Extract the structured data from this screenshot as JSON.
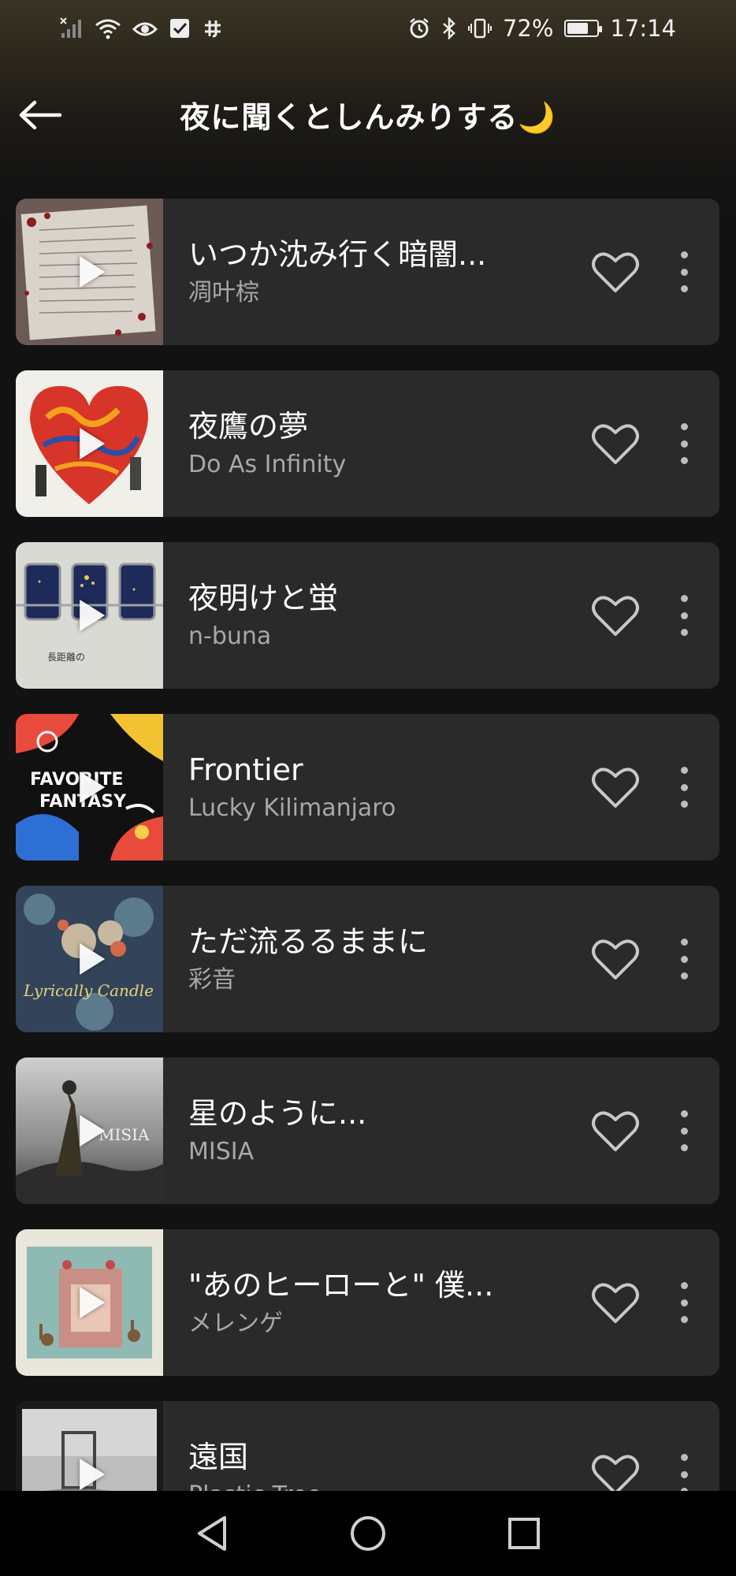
{
  "status_bar": {
    "left_icons": [
      "no-signal-icon",
      "wifi-icon",
      "eye-icon",
      "check-box-icon",
      "app-icon"
    ],
    "alarm_icon": "alarm-icon",
    "bluetooth_icon": "bluetooth-icon",
    "vibrate_icon": "vibrate-icon",
    "battery_percent": "72%",
    "battery_level": 0.72,
    "time": "17:14"
  },
  "header": {
    "back_icon": "arrow-left-icon",
    "title": "夜に聞くとしんみりする🌙"
  },
  "tracks": [
    {
      "title": "いつか沈み行く暗闇...",
      "artist": "凋叶棕"
    },
    {
      "title": "夜鷹の夢",
      "artist": "Do As Infinity"
    },
    {
      "title": "夜明けと蛍",
      "artist": "n-buna"
    },
    {
      "title": "Frontier",
      "artist": "Lucky Kilimanjaro"
    },
    {
      "title": "ただ流るるままに",
      "artist": "彩音"
    },
    {
      "title": "星のように...",
      "artist": "MISIA"
    },
    {
      "title": "\"あのヒーローと\" 僕...",
      "artist": "メレンゲ"
    },
    {
      "title": "遠国",
      "artist": "Plastic Tree"
    }
  ],
  "colors": {
    "background": "#121212",
    "card": "#2a2a2a",
    "secondary_text": "#a8a8a8"
  },
  "nav_bar": {
    "back_icon": "triangle-back-icon",
    "home_icon": "circle-home-icon",
    "recents_icon": "square-recents-icon"
  }
}
